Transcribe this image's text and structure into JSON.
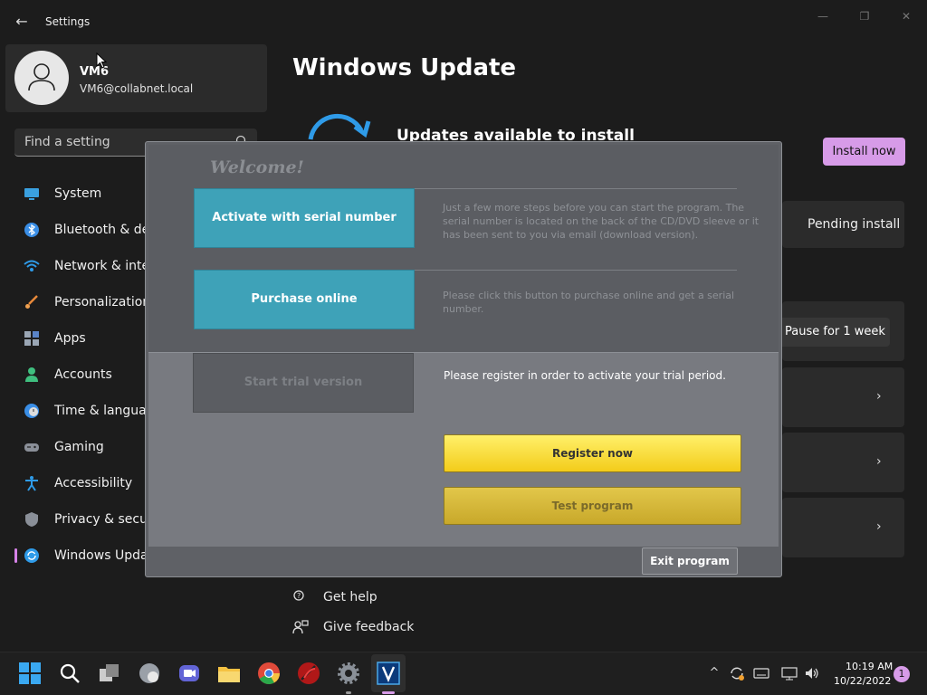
{
  "window": {
    "back_glyph": "←",
    "title": "Settings",
    "minimize_glyph": "—",
    "maximize_glyph": "❐",
    "close_glyph": "✕"
  },
  "profile": {
    "name": "VM6",
    "email": "VM6@collabnet.local"
  },
  "search": {
    "placeholder": "Find a setting"
  },
  "sidebar": {
    "items": [
      {
        "label": "System",
        "icon": "monitor-icon"
      },
      {
        "label": "Bluetooth & devices",
        "icon": "bluetooth-icon"
      },
      {
        "label": "Network & internet",
        "icon": "wifi-icon"
      },
      {
        "label": "Personalization",
        "icon": "brush-icon"
      },
      {
        "label": "Apps",
        "icon": "apps-icon"
      },
      {
        "label": "Accounts",
        "icon": "person-icon"
      },
      {
        "label": "Time & language",
        "icon": "clock-globe-icon"
      },
      {
        "label": "Gaming",
        "icon": "gamepad-icon"
      },
      {
        "label": "Accessibility",
        "icon": "accessibility-icon"
      },
      {
        "label": "Privacy & security",
        "icon": "shield-icon"
      },
      {
        "label": "Windows Update",
        "icon": "sync-icon",
        "active": true
      }
    ]
  },
  "main": {
    "title": "Windows Update",
    "status": "Updates available to install",
    "install_button": "Install now",
    "pending": "Pending install",
    "pause_button": "Pause for 1 week",
    "chevron_glyph": "›",
    "get_help": "Get help",
    "give_feedback": "Give feedback"
  },
  "dialog": {
    "welcome": "Welcome!",
    "activate_button": "Activate with serial number",
    "activate_desc": "Just a few more steps before you can start the program. The serial number is located on the back of the CD/DVD sleeve or it has been sent to you via email (download version).",
    "purchase_button": "Purchase online",
    "purchase_desc": "Please click this button to purchase online and get a serial number.",
    "trial_button": "Start trial version",
    "trial_note": "Please register in order to activate your trial period.",
    "register_button": "Register now",
    "test_button": "Test program",
    "exit_button": "Exit program"
  },
  "taskbar": {
    "apps": [
      "start-icon",
      "search-icon",
      "task-view-icon",
      "edge-icon",
      "teams-icon",
      "file-explorer-icon",
      "chrome-icon",
      "app-red-icon",
      "settings-gear-icon",
      "app-v-icon"
    ],
    "time": "10:19 AM",
    "date": "10/22/2022",
    "notifications": "1",
    "chevron_up_glyph": "^"
  },
  "colors": {
    "accent": "#d79be8",
    "dialog_button": "#3ea2b8",
    "register_yellow": "#f3cc1a"
  }
}
